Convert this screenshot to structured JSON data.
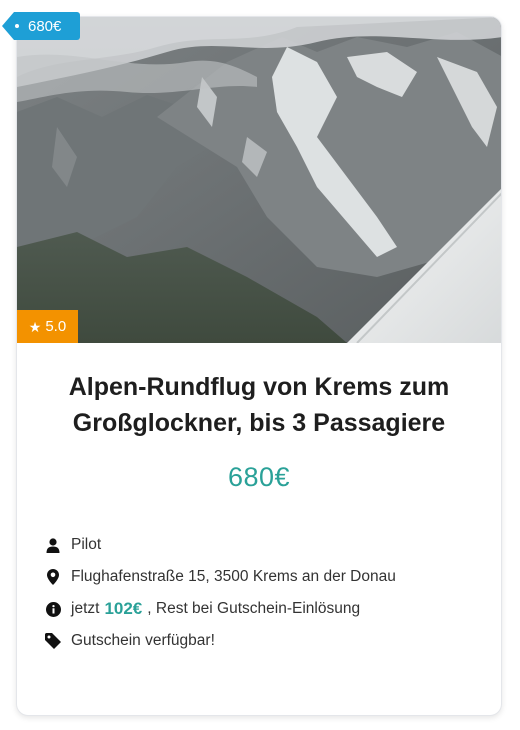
{
  "offer": {
    "price_tag": "680€",
    "rating": "5.0",
    "title": "Alpen-Rundflug von Krems zum Großglockner, bis 3 Passagiere",
    "price": "680€",
    "features": {
      "type": "Pilot",
      "address": "Flughafenstraße 15, 3500 Krems an der Donau",
      "deposit_prefix": "jetzt",
      "deposit_amount": "102€",
      "deposit_suffix": ", Rest bei Gutschein-Einlösung",
      "voucher": "Gutschein verfügbar!"
    }
  },
  "colors": {
    "accent": "#2aa198",
    "price_tag": "#1e9fd6",
    "rating_badge": "#f39200"
  },
  "icons": {
    "photo": "mountain-aerial-photo",
    "type": "user-icon",
    "address": "map-marker-icon",
    "deposit": "info-circle-icon",
    "voucher": "tag-icon",
    "rating": "star-icon"
  }
}
